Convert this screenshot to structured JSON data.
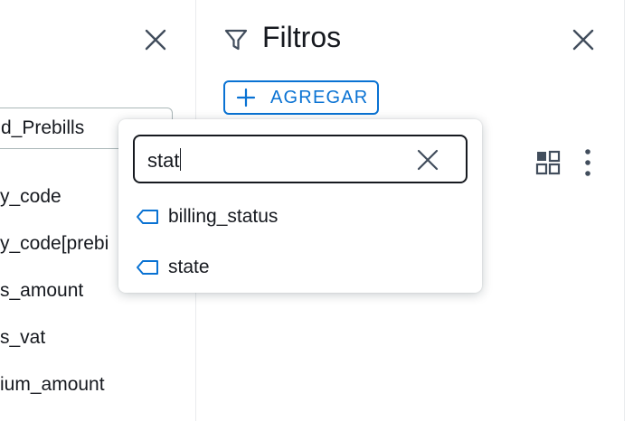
{
  "fields_panel": {
    "dataset_value": "d_Prebills",
    "fields": [
      "y_code",
      "y_code[prebi",
      "s_amount",
      "s_vat",
      "ium_amount"
    ]
  },
  "filters_panel": {
    "title": "Filtros",
    "add_button_label": "AGREGAR"
  },
  "field_search": {
    "query": "stat",
    "results": [
      {
        "label": "billing_status",
        "icon": "dimension-tag-icon"
      },
      {
        "label": "state",
        "icon": "dimension-tag-icon"
      }
    ]
  },
  "colors": {
    "accent": "#0972d3",
    "text": "#16191f",
    "icon": "#414d5c"
  }
}
